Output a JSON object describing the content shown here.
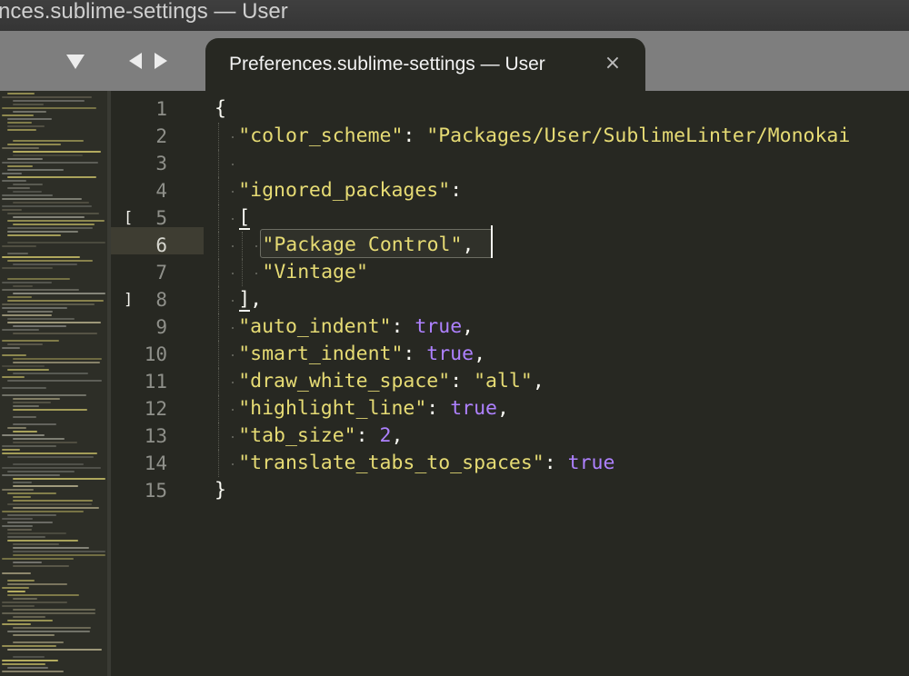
{
  "window": {
    "title": "nces.sublime-settings — User"
  },
  "tabs": [
    {
      "title": "Preferences.sublime-settings — User",
      "close_glyph": "×",
      "active": true
    }
  ],
  "icons": {
    "tab_dropdown": "triangle-down-icon",
    "nav_prev": "triangle-left-icon",
    "nav_next": "triangle-right-icon",
    "close": "close-icon"
  },
  "editor": {
    "current_line": 6,
    "line_numbers": [
      "1",
      "2",
      "3",
      "4",
      "5",
      "6",
      "7",
      "8",
      "9",
      "10",
      "11",
      "12",
      "13",
      "14",
      "15"
    ],
    "fold_markers": [
      {
        "line": 5,
        "glyph": "["
      },
      {
        "line": 8,
        "glyph": "]"
      }
    ],
    "lines": [
      {
        "indent": 0,
        "parts": [
          {
            "t": "{",
            "c": "punc"
          }
        ]
      },
      {
        "indent": 1,
        "parts": [
          {
            "t": "\"color_scheme\"",
            "c": "key"
          },
          {
            "t": ": ",
            "c": "punc"
          },
          {
            "t": "\"Packages/User/SublimeLinter/Monokai",
            "c": "str"
          }
        ]
      },
      {
        "indent": 1,
        "parts": []
      },
      {
        "indent": 1,
        "parts": [
          {
            "t": "\"ignored_packages\"",
            "c": "key"
          },
          {
            "t": ":",
            "c": "punc"
          }
        ]
      },
      {
        "indent": 1,
        "parts": [
          {
            "t": "[",
            "c": "punc"
          }
        ]
      },
      {
        "indent": 2,
        "parts": [
          {
            "t": "\"Package Control\"",
            "c": "str"
          },
          {
            "t": ",",
            "c": "punc"
          }
        ]
      },
      {
        "indent": 2,
        "parts": [
          {
            "t": "\"Vintage\"",
            "c": "str"
          }
        ]
      },
      {
        "indent": 1,
        "parts": [
          {
            "t": "],",
            "c": "punc"
          }
        ]
      },
      {
        "indent": 1,
        "parts": [
          {
            "t": "\"auto_indent\"",
            "c": "key"
          },
          {
            "t": ": ",
            "c": "punc"
          },
          {
            "t": "true",
            "c": "bool"
          },
          {
            "t": ",",
            "c": "punc"
          }
        ]
      },
      {
        "indent": 1,
        "parts": [
          {
            "t": "\"smart_indent\"",
            "c": "key"
          },
          {
            "t": ": ",
            "c": "punc"
          },
          {
            "t": "true",
            "c": "bool"
          },
          {
            "t": ",",
            "c": "punc"
          }
        ]
      },
      {
        "indent": 1,
        "parts": [
          {
            "t": "\"draw_white_space\"",
            "c": "key"
          },
          {
            "t": ": ",
            "c": "punc"
          },
          {
            "t": "\"all\"",
            "c": "str"
          },
          {
            "t": ",",
            "c": "punc"
          }
        ]
      },
      {
        "indent": 1,
        "parts": [
          {
            "t": "\"highlight_line\"",
            "c": "key"
          },
          {
            "t": ": ",
            "c": "punc"
          },
          {
            "t": "true",
            "c": "bool"
          },
          {
            "t": ",",
            "c": "punc"
          }
        ]
      },
      {
        "indent": 1,
        "parts": [
          {
            "t": "\"tab_size\"",
            "c": "key"
          },
          {
            "t": ": ",
            "c": "punc"
          },
          {
            "t": "2",
            "c": "num"
          },
          {
            "t": ",",
            "c": "punc"
          }
        ]
      },
      {
        "indent": 1,
        "parts": [
          {
            "t": "\"translate_tabs_to_spaces\"",
            "c": "key"
          },
          {
            "t": ": ",
            "c": "punc"
          },
          {
            "t": "true",
            "c": "bool"
          }
        ]
      },
      {
        "indent": 0,
        "parts": [
          {
            "t": "}",
            "c": "punc"
          }
        ]
      }
    ]
  },
  "colors": {
    "background": "#272822",
    "string": "#e6db74",
    "constant": "#ae81ff",
    "foreground": "#f8f8f2",
    "line_number": "#8f908a",
    "current_line": "#3e3d32",
    "tab_strip": "#7e7e7e"
  }
}
